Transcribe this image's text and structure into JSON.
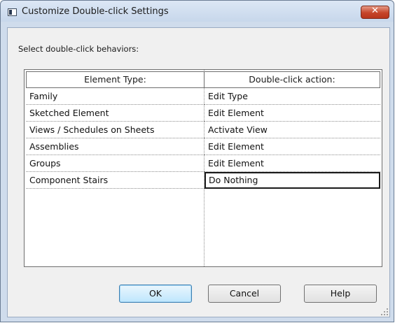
{
  "window": {
    "title": "Customize Double-click Settings",
    "close_glyph": "✕"
  },
  "instruction": "Select double-click behaviors:",
  "grid": {
    "columns": [
      "Element Type:",
      "Double-click action:"
    ],
    "rows": [
      {
        "element": "Family",
        "action": "Edit Type"
      },
      {
        "element": "Sketched Element",
        "action": "Edit Element"
      },
      {
        "element": "Views / Schedules on Sheets",
        "action": "Activate View"
      },
      {
        "element": "Assemblies",
        "action": "Edit Element"
      },
      {
        "element": "Groups",
        "action": "Edit Element"
      },
      {
        "element": "Component Stairs",
        "action": "Do Nothing"
      }
    ],
    "selected_row": 5
  },
  "buttons": {
    "ok": "OK",
    "cancel": "Cancel",
    "help": "Help"
  },
  "icons": {
    "app_icon": "dialog-window-icon",
    "close": "close-icon",
    "grip": "resize-grip-icon"
  },
  "colors": {
    "close_button": "#c6452a",
    "default_button_border": "#3c7fb1",
    "window_frame": "#cfdcec"
  }
}
